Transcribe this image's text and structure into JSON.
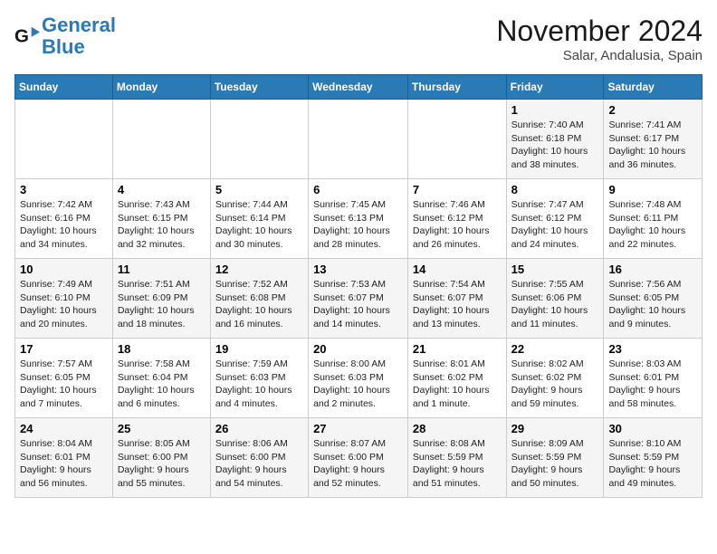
{
  "header": {
    "logo_line1": "General",
    "logo_line2": "Blue",
    "month_title": "November 2024",
    "location": "Salar, Andalusia, Spain"
  },
  "weekdays": [
    "Sunday",
    "Monday",
    "Tuesday",
    "Wednesday",
    "Thursday",
    "Friday",
    "Saturday"
  ],
  "weeks": [
    [
      {
        "day": "",
        "detail": ""
      },
      {
        "day": "",
        "detail": ""
      },
      {
        "day": "",
        "detail": ""
      },
      {
        "day": "",
        "detail": ""
      },
      {
        "day": "",
        "detail": ""
      },
      {
        "day": "1",
        "detail": "Sunrise: 7:40 AM\nSunset: 6:18 PM\nDaylight: 10 hours\nand 38 minutes."
      },
      {
        "day": "2",
        "detail": "Sunrise: 7:41 AM\nSunset: 6:17 PM\nDaylight: 10 hours\nand 36 minutes."
      }
    ],
    [
      {
        "day": "3",
        "detail": "Sunrise: 7:42 AM\nSunset: 6:16 PM\nDaylight: 10 hours\nand 34 minutes."
      },
      {
        "day": "4",
        "detail": "Sunrise: 7:43 AM\nSunset: 6:15 PM\nDaylight: 10 hours\nand 32 minutes."
      },
      {
        "day": "5",
        "detail": "Sunrise: 7:44 AM\nSunset: 6:14 PM\nDaylight: 10 hours\nand 30 minutes."
      },
      {
        "day": "6",
        "detail": "Sunrise: 7:45 AM\nSunset: 6:13 PM\nDaylight: 10 hours\nand 28 minutes."
      },
      {
        "day": "7",
        "detail": "Sunrise: 7:46 AM\nSunset: 6:12 PM\nDaylight: 10 hours\nand 26 minutes."
      },
      {
        "day": "8",
        "detail": "Sunrise: 7:47 AM\nSunset: 6:12 PM\nDaylight: 10 hours\nand 24 minutes."
      },
      {
        "day": "9",
        "detail": "Sunrise: 7:48 AM\nSunset: 6:11 PM\nDaylight: 10 hours\nand 22 minutes."
      }
    ],
    [
      {
        "day": "10",
        "detail": "Sunrise: 7:49 AM\nSunset: 6:10 PM\nDaylight: 10 hours\nand 20 minutes."
      },
      {
        "day": "11",
        "detail": "Sunrise: 7:51 AM\nSunset: 6:09 PM\nDaylight: 10 hours\nand 18 minutes."
      },
      {
        "day": "12",
        "detail": "Sunrise: 7:52 AM\nSunset: 6:08 PM\nDaylight: 10 hours\nand 16 minutes."
      },
      {
        "day": "13",
        "detail": "Sunrise: 7:53 AM\nSunset: 6:07 PM\nDaylight: 10 hours\nand 14 minutes."
      },
      {
        "day": "14",
        "detail": "Sunrise: 7:54 AM\nSunset: 6:07 PM\nDaylight: 10 hours\nand 13 minutes."
      },
      {
        "day": "15",
        "detail": "Sunrise: 7:55 AM\nSunset: 6:06 PM\nDaylight: 10 hours\nand 11 minutes."
      },
      {
        "day": "16",
        "detail": "Sunrise: 7:56 AM\nSunset: 6:05 PM\nDaylight: 10 hours\nand 9 minutes."
      }
    ],
    [
      {
        "day": "17",
        "detail": "Sunrise: 7:57 AM\nSunset: 6:05 PM\nDaylight: 10 hours\nand 7 minutes."
      },
      {
        "day": "18",
        "detail": "Sunrise: 7:58 AM\nSunset: 6:04 PM\nDaylight: 10 hours\nand 6 minutes."
      },
      {
        "day": "19",
        "detail": "Sunrise: 7:59 AM\nSunset: 6:03 PM\nDaylight: 10 hours\nand 4 minutes."
      },
      {
        "day": "20",
        "detail": "Sunrise: 8:00 AM\nSunset: 6:03 PM\nDaylight: 10 hours\nand 2 minutes."
      },
      {
        "day": "21",
        "detail": "Sunrise: 8:01 AM\nSunset: 6:02 PM\nDaylight: 10 hours\nand 1 minute."
      },
      {
        "day": "22",
        "detail": "Sunrise: 8:02 AM\nSunset: 6:02 PM\nDaylight: 9 hours\nand 59 minutes."
      },
      {
        "day": "23",
        "detail": "Sunrise: 8:03 AM\nSunset: 6:01 PM\nDaylight: 9 hours\nand 58 minutes."
      }
    ],
    [
      {
        "day": "24",
        "detail": "Sunrise: 8:04 AM\nSunset: 6:01 PM\nDaylight: 9 hours\nand 56 minutes."
      },
      {
        "day": "25",
        "detail": "Sunrise: 8:05 AM\nSunset: 6:00 PM\nDaylight: 9 hours\nand 55 minutes."
      },
      {
        "day": "26",
        "detail": "Sunrise: 8:06 AM\nSunset: 6:00 PM\nDaylight: 9 hours\nand 54 minutes."
      },
      {
        "day": "27",
        "detail": "Sunrise: 8:07 AM\nSunset: 6:00 PM\nDaylight: 9 hours\nand 52 minutes."
      },
      {
        "day": "28",
        "detail": "Sunrise: 8:08 AM\nSunset: 5:59 PM\nDaylight: 9 hours\nand 51 minutes."
      },
      {
        "day": "29",
        "detail": "Sunrise: 8:09 AM\nSunset: 5:59 PM\nDaylight: 9 hours\nand 50 minutes."
      },
      {
        "day": "30",
        "detail": "Sunrise: 8:10 AM\nSunset: 5:59 PM\nDaylight: 9 hours\nand 49 minutes."
      }
    ]
  ]
}
